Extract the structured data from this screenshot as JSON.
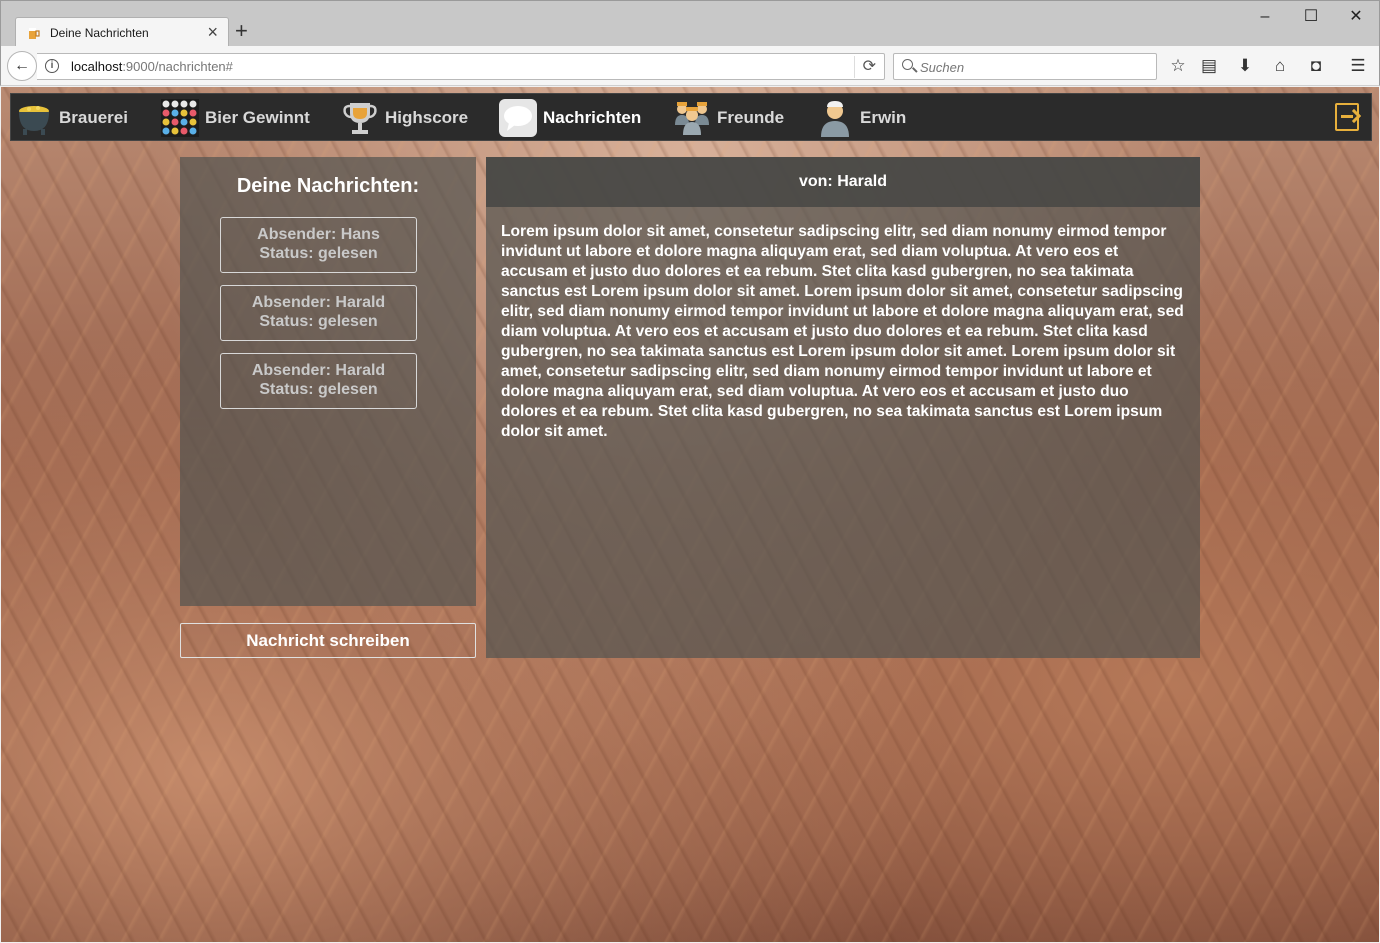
{
  "browser": {
    "tab_title": "Deine Nachrichten",
    "url_host": "localhost",
    "url_rest": ":9000/nachrichten#",
    "search_placeholder": "Suchen"
  },
  "nav": {
    "items": [
      {
        "label": "Brauerei",
        "icon": "cauldron-icon"
      },
      {
        "label": "Bier Gewinnt",
        "icon": "game-grid-icon"
      },
      {
        "label": "Highscore",
        "icon": "trophy-icon"
      },
      {
        "label": "Nachrichten",
        "icon": "speech-bubble-icon",
        "active": true
      },
      {
        "label": "Freunde",
        "icon": "friends-icon"
      },
      {
        "label": "Erwin",
        "icon": "user-icon"
      }
    ],
    "logout_icon": "logout-icon",
    "accent_color": "#e8b03c"
  },
  "inbox": {
    "title": "Deine Nachrichten:",
    "messages": [
      {
        "sender": "Absender: Hans",
        "status": "Status: gelesen"
      },
      {
        "sender": "Absender: Harald",
        "status": "Status: gelesen"
      },
      {
        "sender": "Absender: Harald",
        "status": "Status: gelesen"
      }
    ],
    "write_button": "Nachricht schreiben"
  },
  "reader": {
    "from": "von: Harald",
    "body": "Lorem ipsum dolor sit amet, consetetur sadipscing elitr, sed diam nonumy eirmod tempor invidunt ut labore et dolore magna aliquyam erat, sed diam voluptua. At vero eos et accusam et justo duo dolores et ea rebum. Stet clita kasd gubergren, no sea takimata sanctus est Lorem ipsum dolor sit amet. Lorem ipsum dolor sit amet, consetetur sadipscing elitr, sed diam nonumy eirmod tempor invidunt ut labore et dolore magna aliquyam erat, sed diam voluptua. At vero eos et accusam et justo duo dolores et ea rebum. Stet clita kasd gubergren, no sea takimata sanctus est Lorem ipsum dolor sit amet. Lorem ipsum dolor sit amet, consetetur sadipscing elitr, sed diam nonumy eirmod tempor invidunt ut labore et dolore magna aliquyam erat, sed diam voluptua. At vero eos et accusam et justo duo dolores et ea rebum. Stet clita kasd gubergren, no sea takimata sanctus est Lorem ipsum dolor sit amet."
  }
}
